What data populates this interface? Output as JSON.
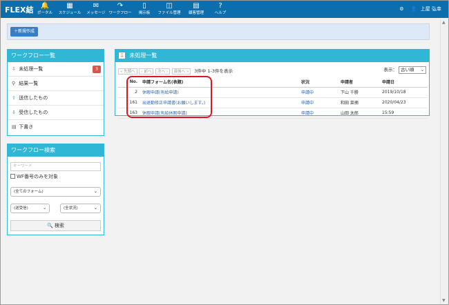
{
  "topbar": {
    "logo": "FLEX結",
    "nav": [
      {
        "icon": "🔔",
        "label": "ポータル",
        "name": "portal"
      },
      {
        "icon": "▦",
        "label": "スケジュール",
        "name": "schedule"
      },
      {
        "icon": "✉",
        "label": "メッセージ",
        "name": "message"
      },
      {
        "icon": "↷",
        "label": "ワークフロー",
        "name": "workflow"
      },
      {
        "icon": "▯",
        "label": "掲示板",
        "name": "bulletin"
      },
      {
        "icon": "◫",
        "label": "ファイル管理",
        "name": "file"
      },
      {
        "icon": "▤",
        "label": "顧客管理",
        "name": "customer"
      },
      {
        "icon": "?",
        "label": "ヘルプ",
        "name": "help"
      }
    ],
    "settings_icon": "⚙",
    "user_icon": "👤",
    "user_name": "上屋 弘幸"
  },
  "toolbar": {
    "new_label": "＋新規作成"
  },
  "wf_list": {
    "title": "ワークフロー一覧",
    "items": [
      {
        "icon": "⇩",
        "label": "未処理一覧",
        "badge": "3",
        "color": "#d9534f"
      },
      {
        "icon": "⚲",
        "label": "結果一覧",
        "badge": "",
        "color": "#555"
      },
      {
        "icon": "⇧",
        "label": "送信したもの",
        "badge": "",
        "color": "#2a9fd6"
      },
      {
        "icon": "⇩",
        "label": "受信したもの",
        "badge": "",
        "color": "#2e8b57"
      },
      {
        "icon": "▤",
        "label": "下書き",
        "badge": "",
        "color": "#555"
      }
    ]
  },
  "wf_search": {
    "title": "ワークフロー検索",
    "keyword_placeholder": "キーワード",
    "checkbox_label": "WF番号のみを対象",
    "form_select": "(全てのフォーム)",
    "recv_select": "(送受信)",
    "status_select": "(全状況)",
    "search_label": "検索"
  },
  "main": {
    "title": "未処理一覧",
    "pager": {
      "first": "« 先頭へ",
      "prev": "‹ 前へ",
      "next": "次へ ›",
      "last": "最後へ »",
      "count": "3件中 1-3件を表示"
    },
    "display_label": "表示：",
    "display_value": "古い順",
    "columns": [
      "No.",
      "申請フォーム名(表題)",
      "状況",
      "申請者",
      "申請日"
    ],
    "rows": [
      {
        "no": "2",
        "form": "休暇申請(有給申請)",
        "status": "申請中",
        "applicant": "下山 千勝",
        "date": "2019/10/18"
      },
      {
        "no": "161",
        "form": "出退勤修正申請書(お願いします。)",
        "status": "申請中",
        "applicant": "和田 菜摘",
        "date": "2020/04/23"
      },
      {
        "no": "163",
        "form": "休暇申請(有給休暇申請)",
        "status": "申請中",
        "applicant": "山田 太郎",
        "date": "15:59"
      }
    ]
  }
}
